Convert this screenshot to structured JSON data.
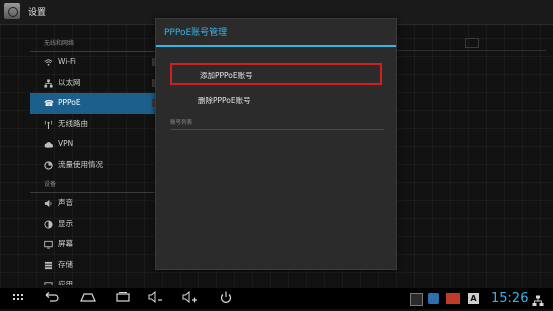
{
  "actionbar": {
    "title": "设置"
  },
  "sidebar": {
    "section_wireless": "无线和网络",
    "items_wireless": [
      {
        "label": "Wi-Fi",
        "icon": "wifi-icon"
      },
      {
        "label": "以太网",
        "icon": "ethernet-icon"
      },
      {
        "label": "PPPoE",
        "icon": "phone-icon",
        "selected": true
      },
      {
        "label": "无线路由",
        "icon": "router-icon"
      },
      {
        "label": "VPN",
        "icon": "vpn-icon"
      },
      {
        "label": "流量使用情况",
        "icon": "data-usage-icon"
      }
    ],
    "section_device": "设备",
    "items_device": [
      {
        "label": "声音",
        "icon": "sound-icon"
      },
      {
        "label": "显示",
        "icon": "display-icon"
      },
      {
        "label": "屏幕",
        "icon": "screen-icon"
      },
      {
        "label": "存储",
        "icon": "storage-icon"
      },
      {
        "label": "应用",
        "icon": "apps-icon"
      }
    ]
  },
  "dialog": {
    "title": "PPPoE账号管理",
    "add_label": "添加PPPoE账号",
    "delete_label": "删除PPPoE账号",
    "list_header": "账号列表"
  },
  "navbar": {
    "clock": "15:26",
    "buttons": [
      "apps-grid-icon",
      "back-icon",
      "home-icon",
      "recent-apps-icon",
      "volume-down-icon",
      "volume-up-icon",
      "power-icon"
    ]
  },
  "colors": {
    "accent": "#33b5e5",
    "selected": "#1c5f8c",
    "highlight": "#d11f1f"
  }
}
